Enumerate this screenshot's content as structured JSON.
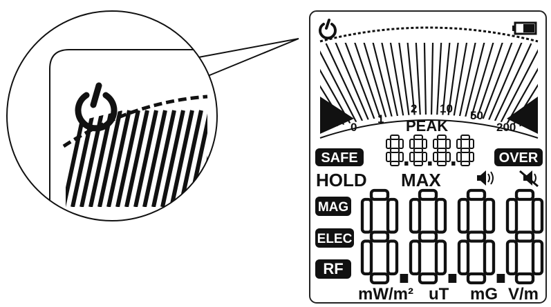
{
  "scale_labels": [
    "0",
    "1",
    "2",
    "10",
    "50",
    "200"
  ],
  "peak_label": "PEAK",
  "safe_label": "SAFE",
  "over_label": "OVER",
  "hold_label": "HOLD",
  "max_label": "MAX",
  "mode_labels": [
    "MAG",
    "ELEC",
    "RF"
  ],
  "units": [
    "mW/m²",
    "uT",
    "mG",
    "V/m"
  ],
  "icons": {
    "power": "power-icon",
    "battery": "battery-icon",
    "sound_on": "speaker-on-icon",
    "sound_off": "speaker-mute-icon"
  },
  "colors": {
    "segment": "#111111",
    "background": "#ffffff"
  }
}
